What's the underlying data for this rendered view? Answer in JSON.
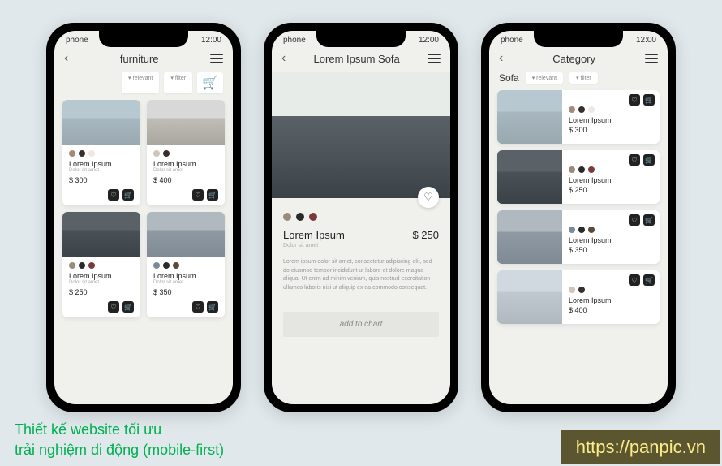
{
  "status": {
    "label": "phone",
    "time": "12:00"
  },
  "screen1": {
    "title": "furniture",
    "relevant": "▾ relevant",
    "filter": "▾ filter",
    "products": [
      {
        "name": "Lorem Ipsum",
        "sub": "Dolor sit amet",
        "price": "$ 300",
        "swatches": [
          "#a48a7a",
          "#3a2e2a",
          "#f0e8e0"
        ],
        "img": "sofa1"
      },
      {
        "name": "Lorem Ipsum",
        "sub": "Dolor sit amet",
        "price": "$ 400",
        "swatches": [
          "#d0c4b8",
          "#3a2e2a"
        ],
        "img": "sofa2"
      },
      {
        "name": "Lorem Ipsum",
        "sub": "Dolor sit amet",
        "price": "$ 250",
        "swatches": [
          "#9a8a7a",
          "#2a2a2a",
          "#7a3a3a"
        ],
        "img": "sofa3"
      },
      {
        "name": "Lorem Ipsum",
        "sub": "Dolor sit amet",
        "price": "$ 350",
        "swatches": [
          "#7a8a9a",
          "#2a2a2a",
          "#5a4a3a"
        ],
        "img": "sofa4"
      }
    ]
  },
  "screen2": {
    "title": "Lorem Ipsum Sofa",
    "product": {
      "name": "Lorem Ipsum",
      "sub": "Dolor sit amet",
      "price": "$ 250",
      "swatches": [
        "#9a8a7a",
        "#2a2a2a",
        "#7a3a3a"
      ],
      "desc": "Lorem ipsum dolor sit amet, consectetur adipiscing elit, sed do eiusmod tempor incididunt ut labore et dolore magna aliqua. Ut enim ad minim veniam, quis nostrud exercitation ullamco laboris nisi ut aliquip ex ea commodo consequat.",
      "cta": "add to chart"
    }
  },
  "screen3": {
    "title": "Category",
    "category": "Sofa",
    "relevant": "▾ relevant",
    "filter": "▾ filter",
    "products": [
      {
        "name": "Lorem Ipsum",
        "price": "$ 300",
        "swatches": [
          "#a48a7a",
          "#3a2e2a",
          "#f0e8e0"
        ],
        "img": "sofa1"
      },
      {
        "name": "Lorem Ipsum",
        "price": "$ 250",
        "swatches": [
          "#9a8a7a",
          "#2a2a2a",
          "#7a3a3a"
        ],
        "img": "sofa3"
      },
      {
        "name": "Lorem Ipsum",
        "price": "$ 350",
        "swatches": [
          "#7a8a9a",
          "#2a2a2a",
          "#5a4a3a"
        ],
        "img": "sofa4"
      },
      {
        "name": "Lorem Ipsum",
        "price": "$ 400",
        "swatches": [
          "#d0c4b8",
          "#3a2e2a"
        ],
        "img": "sofa5"
      }
    ]
  },
  "caption": {
    "line1": "Thiết kế website tối ưu",
    "line2": "trải nghiệm di động (mobile-first)"
  },
  "url": "https://panpic.vn"
}
